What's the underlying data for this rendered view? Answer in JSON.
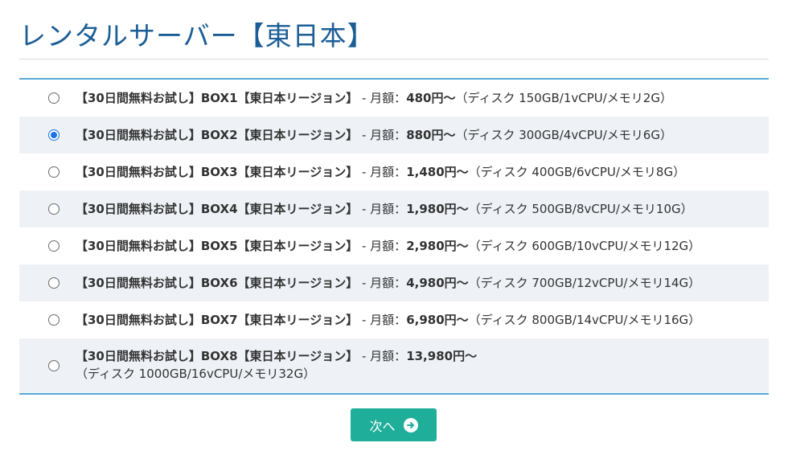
{
  "page": {
    "title": "レンタルサーバー【東日本】"
  },
  "plans": [
    {
      "name": "【30日間無料お試し】BOX1【東日本リージョン】",
      "sep": " - 月額：",
      "price": "480円〜",
      "spec": "（ディスク 150GB/1vCPU/メモリ2G）",
      "selected": false
    },
    {
      "name": "【30日間無料お試し】BOX2【東日本リージョン】",
      "sep": " - 月額：",
      "price": "880円〜",
      "spec": "（ディスク 300GB/4vCPU/メモリ6G）",
      "selected": true
    },
    {
      "name": "【30日間無料お試し】BOX3【東日本リージョン】",
      "sep": " - 月額：",
      "price": "1,480円〜",
      "spec": "（ディスク 400GB/6vCPU/メモリ8G）",
      "selected": false
    },
    {
      "name": "【30日間無料お試し】BOX4【東日本リージョン】",
      "sep": " - 月額：",
      "price": "1,980円〜",
      "spec": "（ディスク 500GB/8vCPU/メモリ10G）",
      "selected": false
    },
    {
      "name": "【30日間無料お試し】BOX5【東日本リージョン】",
      "sep": " - 月額：",
      "price": "2,980円〜",
      "spec": "（ディスク 600GB/10vCPU/メモリ12G）",
      "selected": false
    },
    {
      "name": "【30日間無料お試し】BOX6【東日本リージョン】",
      "sep": " - 月額：",
      "price": "4,980円〜",
      "spec": "（ディスク 700GB/12vCPU/メモリ14G）",
      "selected": false
    },
    {
      "name": "【30日間無料お試し】BOX7【東日本リージョン】",
      "sep": " - 月額：",
      "price": "6,980円〜",
      "spec": "（ディスク 800GB/14vCPU/メモリ16G）",
      "selected": false
    },
    {
      "name": "【30日間無料お試し】BOX8【東日本リージョン】",
      "sep": " - 月額：",
      "price": "13,980円〜",
      "spec": "（ディスク 1000GB/16vCPU/メモリ32G）",
      "selected": false
    }
  ],
  "actions": {
    "next_label": "次へ",
    "next_icon": "arrow-right-circle-icon"
  },
  "colors": {
    "title": "#1b5e96",
    "accent_border": "#5aa9d6",
    "button": "#1fae9a",
    "row_alt": "#eef2f6"
  }
}
